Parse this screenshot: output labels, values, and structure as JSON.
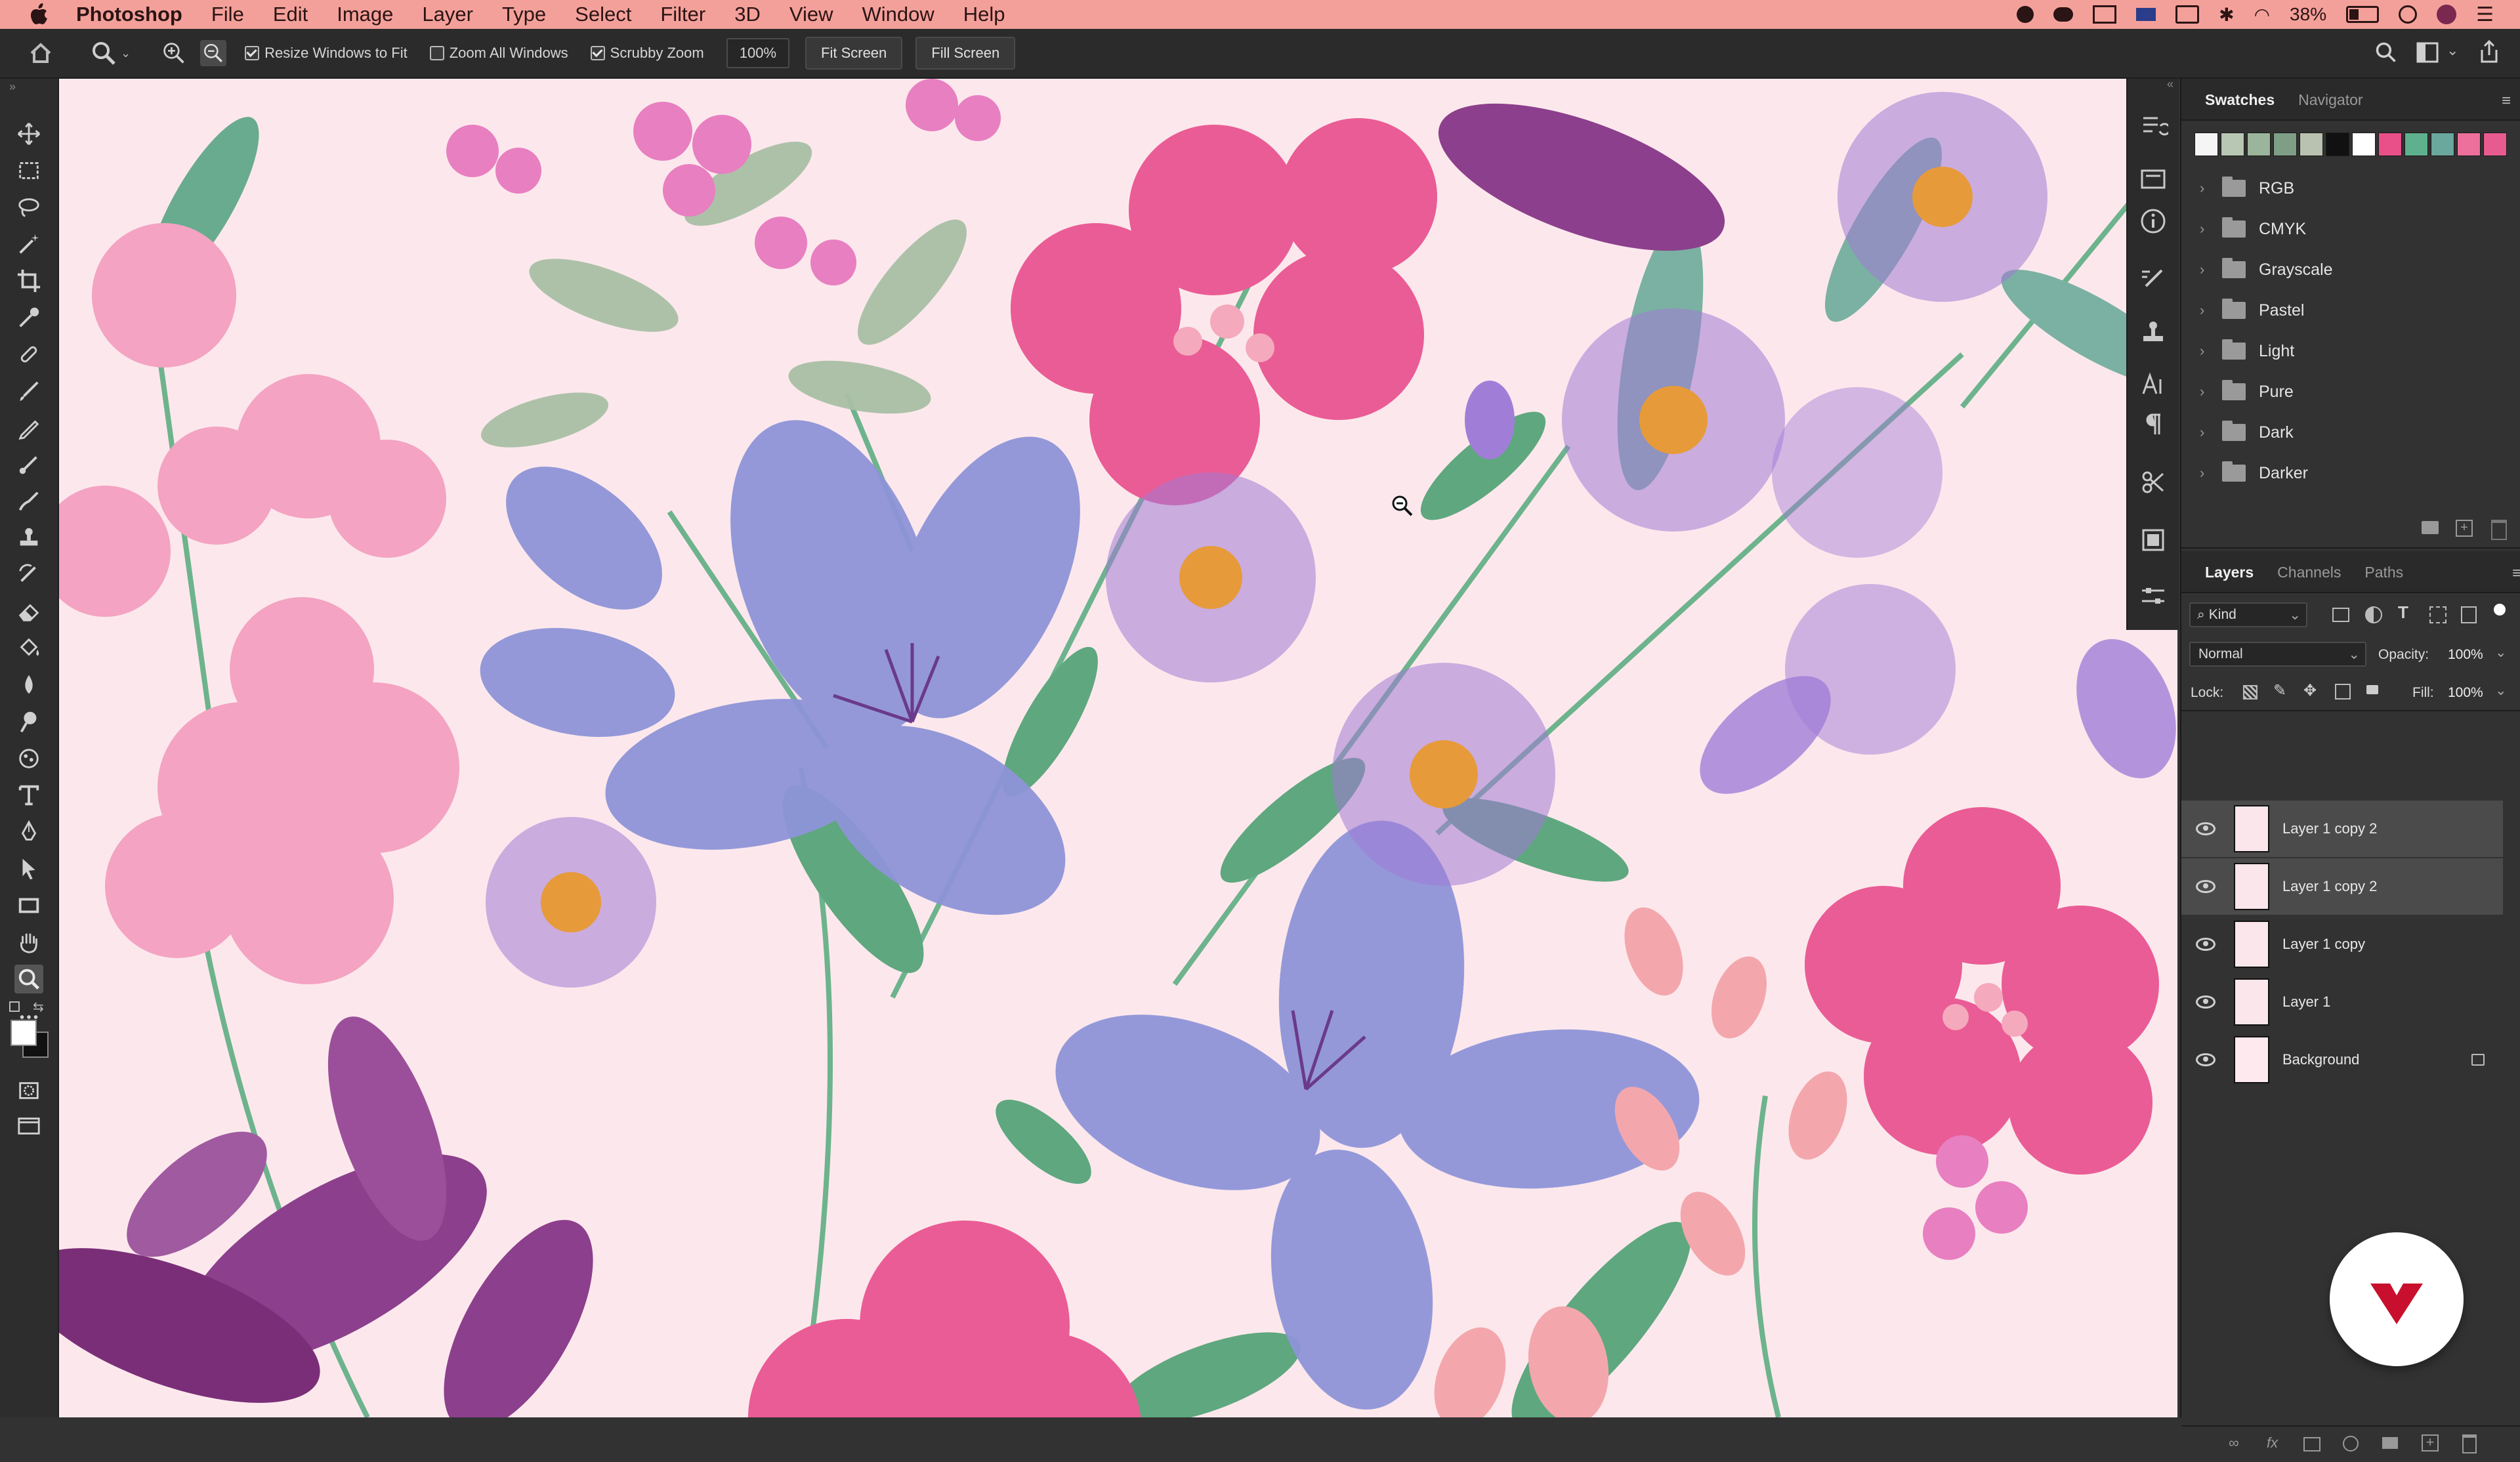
{
  "menubar": {
    "app_name": "Photoshop",
    "items": [
      "File",
      "Edit",
      "Image",
      "Layer",
      "Type",
      "Select",
      "Filter",
      "3D",
      "View",
      "Window",
      "Help"
    ],
    "battery": "38%"
  },
  "options_bar": {
    "resize_windows": "Resize Windows to Fit",
    "zoom_all": "Zoom All Windows",
    "scrubby_zoom": "Scrubby Zoom",
    "zoom_value": "100%",
    "fit_screen": "Fit Screen",
    "fill_screen": "Fill Screen"
  },
  "toolbar": {
    "tools": [
      "move",
      "marquee",
      "lasso",
      "magic-wand",
      "crop",
      "eyedropper",
      "healing-brush",
      "brush",
      "clone-stamp",
      "history-brush",
      "eraser",
      "paint-bucket",
      "blur",
      "dodge",
      "pen",
      "type",
      "path-select",
      "rectangle",
      "hand",
      "zoom"
    ]
  },
  "swatches_panel": {
    "tabs": [
      "Swatches",
      "Navigator"
    ],
    "colors": [
      "#f5f5f5",
      "#b7c7b4",
      "#9bb59c",
      "#7e9f86",
      "#b9c2b0",
      "#111111",
      "#ffffff",
      "#e9508a",
      "#5fb08f",
      "#6aa79c",
      "#ec6f9c",
      "#e85b8f"
    ],
    "folders": [
      "RGB",
      "CMYK",
      "Grayscale",
      "Pastel",
      "Light",
      "Pure",
      "Dark",
      "Darker"
    ]
  },
  "layers_panel": {
    "tabs": [
      "Layers",
      "Channels",
      "Paths"
    ],
    "filter_kind": "Kind",
    "blend_mode": "Normal",
    "opacity_label": "Opacity:",
    "opacity_value": "100%",
    "lock_label": "Lock:",
    "fill_label": "Fill:",
    "fill_value": "100%",
    "layers": [
      {
        "name": "Layer 1 copy 2",
        "selected": true
      },
      {
        "name": "Layer 1 copy 2",
        "selected": true
      },
      {
        "name": "Layer 1 copy",
        "selected": false
      },
      {
        "name": "Layer 1",
        "selected": false
      },
      {
        "name": "Background",
        "selected": false
      }
    ]
  },
  "colors": {
    "menubar_bg": "#f4a09a",
    "canvas_bg": "#fce8ec",
    "panel_bg": "#323232",
    "brand_red": "#c8102e"
  }
}
